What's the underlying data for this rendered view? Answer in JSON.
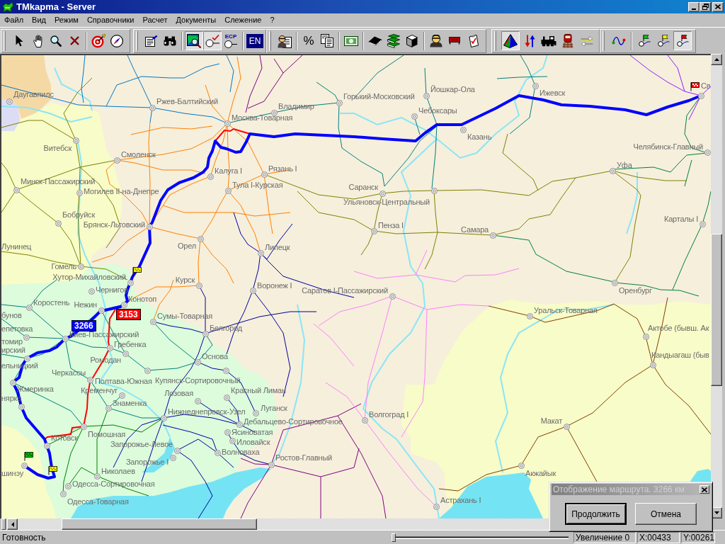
{
  "window": {
    "title": "TMkapma - Server"
  },
  "menu": [
    "Файл",
    "Вид",
    "Режим",
    "Справочники",
    "Расчет",
    "Документы",
    "Слежение",
    "?"
  ],
  "toolbar": {
    "bands": [
      {
        "sections": [
          {
            "buttons": [
              {
                "pressed": false
              },
              {
                "pressed": false
              },
              {
                "pressed": false
              },
              {
                "pressed": false
              }
            ]
          },
          {
            "buttons": [
              {
                "pressed": false
              },
              {
                "pressed": false
              }
            ]
          }
        ]
      },
      {
        "sections": [
          {
            "buttons": [
              {
                "pressed": false
              },
              {
                "pressed": false
              }
            ]
          },
          {
            "buttons": [
              {
                "pressed": true
              },
              {
                "pressed": true
              },
              {
                "label": "ECP",
                "pressed": false
              }
            ]
          },
          {
            "buttons": [
              {
                "label": "EN",
                "pressed": false
              }
            ]
          }
        ]
      },
      {
        "sections": [
          {
            "buttons": [
              {
                "pressed": false
              }
            ]
          },
          {
            "buttons": [
              {
                "label": "%",
                "pressed": false
              },
              {
                "pressed": false
              }
            ]
          },
          {
            "buttons": [
              {
                "pressed": false
              }
            ]
          },
          {
            "buttons": [
              {
                "pressed": false
              },
              {
                "pressed": false
              },
              {
                "pressed": false
              }
            ]
          },
          {
            "buttons": [
              {
                "pressed": false
              },
              {
                "pressed": false
              },
              {
                "pressed": false
              }
            ]
          }
        ]
      },
      {
        "sections": [
          {
            "buttons": [
              {
                "pressed": true
              },
              {
                "pressed": false
              },
              {
                "pressed": false
              },
              {
                "pressed": false
              },
              {
                "pressed": false
              }
            ]
          }
        ]
      },
      {
        "sections": [
          {
            "buttons": [
              {
                "pressed": false
              }
            ]
          },
          {
            "buttons": [
              {
                "pressed": false
              },
              {
                "pressed": false
              },
              {
                "pressed": true
              }
            ]
          }
        ]
      }
    ]
  },
  "map": {
    "stations": [
      "Даугавпилс",
      "Ржев-Балтийский",
      "Горький-Московский",
      "Йошкар-Ола",
      "Ижевск",
      "Св",
      "Владимир",
      "Москва-Товарная",
      "Чебоксары",
      "Казань",
      "Витебск",
      "Челябинск-Главный",
      "Смоленск",
      "Уфа",
      "Калуга I",
      "Рязань I",
      "Минск-Пассажирский",
      "Могилев II-на-Днепре",
      "Тула I-Курская",
      "Саранск",
      "Ульяновск-Центральный",
      "Бобруйск",
      "Брянск-Льговский",
      "Карталы I",
      "Пенза I",
      "Самара",
      "Лунинец",
      "Орел",
      "Липецк",
      "Гомель",
      "Хутор-Михайловский",
      "Курск",
      "Чернигов",
      "Воронеж I",
      "Саратов I-Пассажирский",
      "Оренбург",
      "Конотоп",
      "Коростень",
      "Нежин",
      "бунов",
      "Уральск-Товарная",
      "Сумы-Товарная",
      "епетовка",
      "Белгород",
      "Актобе (бывш. Ак",
      "Киев-Пассажирский",
      "томир",
      "Гребенка",
      "ирский",
      "Основа",
      "Ромодан",
      "Кандыагаш (быв",
      "ельницкий",
      "Черкассы",
      "Полтава-Южная",
      "Купянск-Сортировочный",
      "Жмеринка",
      "Кременчуг",
      "Лозовая",
      "Красный Лиман",
      "нярка",
      "Знаменка",
      "Луганск",
      "Нижнеднепровск-Узел",
      "Дебальцево-Сортировочное",
      "Волгоград I",
      "Макат",
      "Ясиноватая",
      "Помошная",
      "Котовск",
      "Иловайск",
      "Запорожье-Левое",
      "Волноваха",
      "Ростов-Главный",
      "Запорожье I",
      "Николаев",
      "шинэу",
      "Акжайык",
      "Одесса-Сортировочная",
      "Одесса-Товарная",
      "Астрахань I"
    ],
    "route_badges": [
      {
        "label": "3266",
        "color": "#0000ff"
      },
      {
        "label": "3153",
        "color": "#ff0000"
      }
    ]
  },
  "dialog": {
    "title": "Отображение маршрута. 3266 км",
    "active": false,
    "buttons": [
      {
        "label": "Продолжить",
        "default": true
      },
      {
        "label": "Отмена",
        "default": false
      }
    ]
  },
  "status_bar": {
    "text": "Готовность",
    "zoom_slider": {
      "level": 0
    },
    "zoom": "Увеличение 0",
    "x": "X:00433",
    "y": "Y:00261"
  }
}
